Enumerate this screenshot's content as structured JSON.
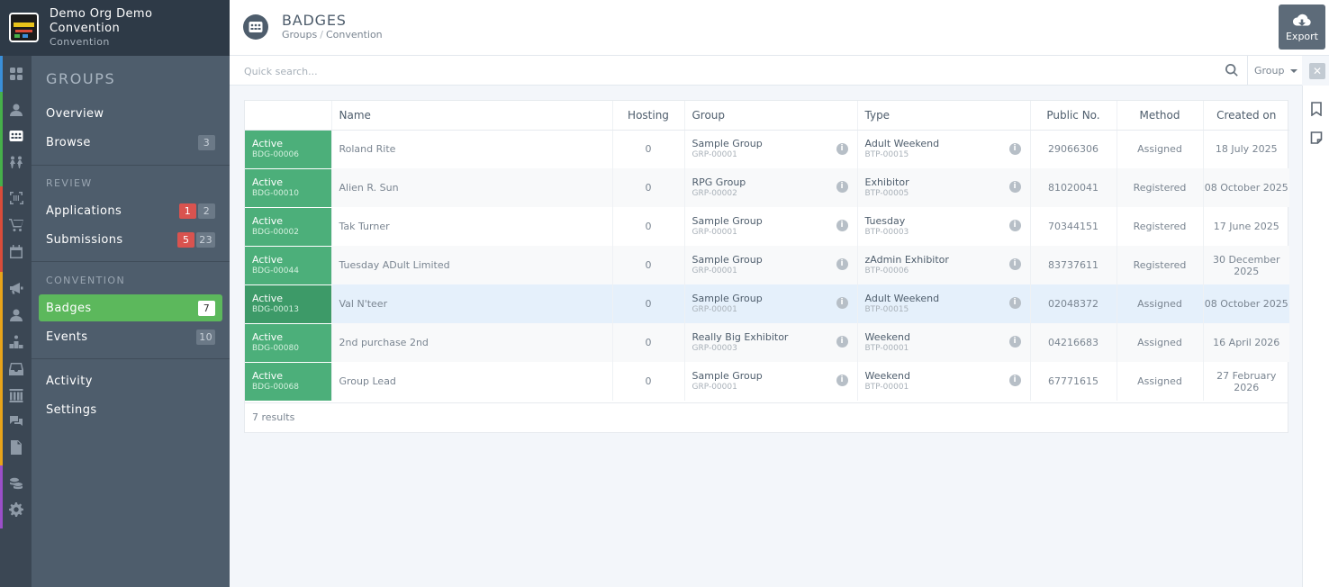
{
  "org": {
    "name": "Demo Org Demo Convention",
    "subtitle": "Convention"
  },
  "nav": {
    "title": "GROUPS",
    "items": [
      {
        "label": "Overview"
      },
      {
        "label": "Browse",
        "count": "3"
      }
    ],
    "review_section": "REVIEW",
    "review_items": [
      {
        "label": "Applications",
        "red": "1",
        "count": "2"
      },
      {
        "label": "Submissions",
        "red": "5",
        "count": "23"
      }
    ],
    "convention_section": "CONVENTION",
    "convention_items": [
      {
        "label": "Badges",
        "count": "7"
      },
      {
        "label": "Events",
        "count": "10"
      }
    ],
    "bottom_items": [
      {
        "label": "Activity"
      },
      {
        "label": "Settings"
      }
    ]
  },
  "header": {
    "title": "BADGES",
    "breadcrumb": [
      "Groups",
      "Convention"
    ],
    "export_label": "Export"
  },
  "search": {
    "placeholder": "Quick search...",
    "filter_label": "Group",
    "close": "✕"
  },
  "table": {
    "columns": [
      "Name",
      "Hosting",
      "Group",
      "Type",
      "Public No.",
      "Method",
      "Created on"
    ],
    "rows": [
      {
        "status": "Active",
        "code": "BDG-00006",
        "name": "Roland Rite",
        "hosting": "0",
        "group": "Sample Group",
        "group_code": "GRP-00001",
        "type": "Adult Weekend",
        "type_code": "BTP-00015",
        "public_no": "29066306",
        "method": "Assigned",
        "created": "18 July 2025"
      },
      {
        "status": "Active",
        "code": "BDG-00010",
        "name": "Alien R. Sun",
        "hosting": "0",
        "group": "RPG Group",
        "group_code": "GRP-00002",
        "type": "Exhibitor",
        "type_code": "BTP-00005",
        "public_no": "81020041",
        "method": "Registered",
        "created": "08 October 2025"
      },
      {
        "status": "Active",
        "code": "BDG-00002",
        "name": "Tak Turner",
        "hosting": "0",
        "group": "Sample Group",
        "group_code": "GRP-00001",
        "type": "Tuesday",
        "type_code": "BTP-00003",
        "public_no": "70344151",
        "method": "Registered",
        "created": "17 June 2025"
      },
      {
        "status": "Active",
        "code": "BDG-00044",
        "name": "Tuesday ADult Limited",
        "hosting": "0",
        "group": "Sample Group",
        "group_code": "GRP-00001",
        "type": "zAdmin Exhibitor",
        "type_code": "BTP-00006",
        "public_no": "83737611",
        "method": "Registered",
        "created": "30 December 2025"
      },
      {
        "status": "Active",
        "code": "BDG-00013",
        "name": "Val N'teer",
        "hosting": "0",
        "group": "Sample Group",
        "group_code": "GRP-00001",
        "type": "Adult Weekend",
        "type_code": "BTP-00015",
        "public_no": "02048372",
        "method": "Assigned",
        "created": "08 October 2025"
      },
      {
        "status": "Active",
        "code": "BDG-00080",
        "name": "2nd purchase 2nd",
        "hosting": "0",
        "group": "Really Big Exhibitor",
        "group_code": "GRP-00003",
        "type": "Weekend",
        "type_code": "BTP-00001",
        "public_no": "04216683",
        "method": "Assigned",
        "created": "16 April 2026"
      },
      {
        "status": "Active",
        "code": "BDG-00068",
        "name": "Group Lead",
        "hosting": "0",
        "group": "Sample Group",
        "group_code": "GRP-00001",
        "type": "Weekend",
        "type_code": "BTP-00001",
        "public_no": "67771615",
        "method": "Assigned",
        "created": "27 February 2026"
      }
    ],
    "results": "7 results"
  },
  "colors": {
    "accent": "#5cb85c",
    "status": "#4caf7a",
    "nav_bg": "#4e5d6c",
    "badge_red": "#d9534f"
  },
  "icons": [
    "dashboard-icon",
    "user-icon",
    "badge-icon",
    "groups-icon",
    "scan-icon",
    "cart-icon",
    "calendar-icon",
    "megaphone-icon",
    "person-icon",
    "ranking-icon",
    "inbox-icon",
    "library-icon",
    "chat-icon",
    "document-icon",
    "coins-icon",
    "gear-icon",
    "search-icon",
    "cloud-download-icon",
    "bookmark-icon",
    "note-icon",
    "info-icon"
  ]
}
